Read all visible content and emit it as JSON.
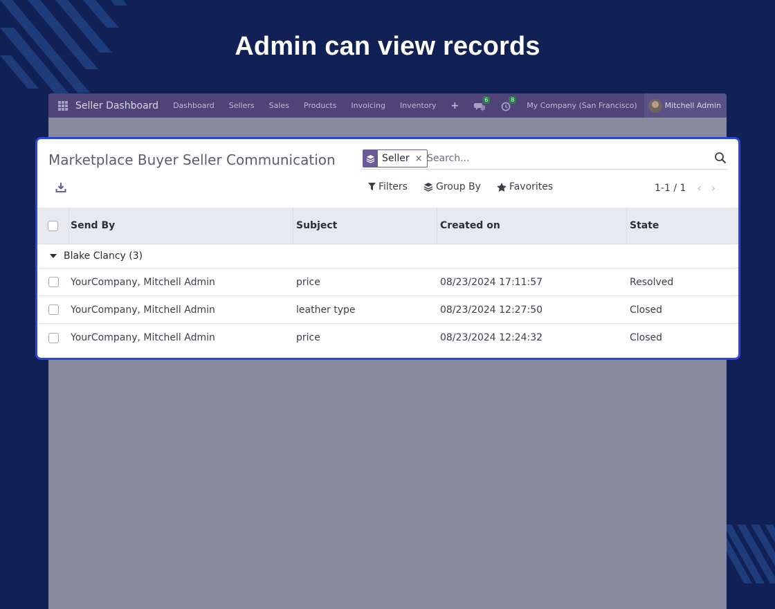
{
  "hero": {
    "title": "Admin can view records"
  },
  "navbar": {
    "brand": "Seller Dashboard",
    "items": [
      "Dashboard",
      "Sellers",
      "Sales",
      "Products",
      "Invoicing",
      "Inventory"
    ],
    "plus": "+",
    "messages_badge": "6",
    "activities_badge": "8",
    "company": "My Company (San Francisco)",
    "user": "Mitchell Admin"
  },
  "control_panel": {
    "title": "Marketplace Buyer Seller Communication",
    "facet_value": "Seller",
    "facet_remove": "×",
    "search_placeholder": "Search...",
    "filters_label": "Filters",
    "groupby_label": "Group By",
    "favorites_label": "Favorites",
    "pager": "1-1 / 1",
    "pager_prev": "‹",
    "pager_next": "›"
  },
  "table": {
    "headers": {
      "send_by": "Send By",
      "subject": "Subject",
      "created_on": "Created on",
      "state": "State"
    },
    "group": "Blake Clancy (3)",
    "rows": [
      {
        "send_by": "YourCompany, Mitchell Admin",
        "subject": "price",
        "created_on": "08/23/2024 17:11:57",
        "state": "Resolved"
      },
      {
        "send_by": "YourCompany, Mitchell Admin",
        "subject": "leather type",
        "created_on": "08/23/2024 12:27:50",
        "state": "Closed"
      },
      {
        "send_by": "YourCompany, Mitchell Admin",
        "subject": "price",
        "created_on": "08/23/2024 12:24:32",
        "state": "Closed"
      }
    ]
  },
  "colors": {
    "background": "#112155",
    "navbar": "#4e4478",
    "accent": "#6b5a9a",
    "highlight_border": "#2c44e0"
  }
}
